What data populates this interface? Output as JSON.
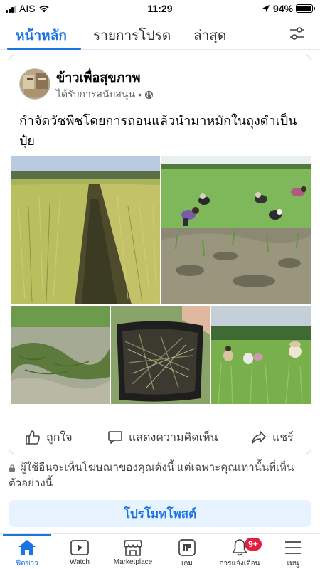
{
  "status": {
    "carrier": "AIS",
    "time": "11:29",
    "battery": "94%",
    "battery_level": 0.94
  },
  "tabs": [
    {
      "label": "หน้าหลัก",
      "active": true
    },
    {
      "label": "รายการโปรด",
      "active": false
    },
    {
      "label": "ล่าสุด",
      "active": false
    }
  ],
  "post": {
    "page_name": "ข้าวเพื่อสุขภาพ",
    "sponsored": "ได้รับการสนับสนุน",
    "text": "กำจัดวัชพืชโดยการถอนแล้วนำมาหมักในถุงดำเป็นปุ๋ย",
    "actions": {
      "like": "ถูกใจ",
      "comment": "แสดงความคิดเห็น",
      "share": "แชร์"
    }
  },
  "notice": "ผู้ใช้อื่นจะเห็นโฆษณาของคุณดังนี้ แต่เฉพาะคุณเท่านั้นที่เห็นตัวอย่างนี้",
  "promote_button": "โปรโมทโพสต์",
  "bottom_nav": [
    {
      "label": "ฟีดข่าว",
      "icon": "home-icon",
      "active": true
    },
    {
      "label": "Watch",
      "icon": "video-icon",
      "active": false
    },
    {
      "label": "Marketplace",
      "icon": "shop-icon",
      "active": false
    },
    {
      "label": "เกม",
      "icon": "game-icon",
      "active": false
    },
    {
      "label": "การแจ้งเตือน",
      "icon": "bell-icon",
      "active": false,
      "badge": "9+"
    },
    {
      "label": "เมนู",
      "icon": "menu-icon",
      "active": false
    }
  ],
  "colors": {
    "accent": "#1b74e4",
    "badge": "#e41e3f",
    "promote_bg": "#e7f3ff"
  }
}
